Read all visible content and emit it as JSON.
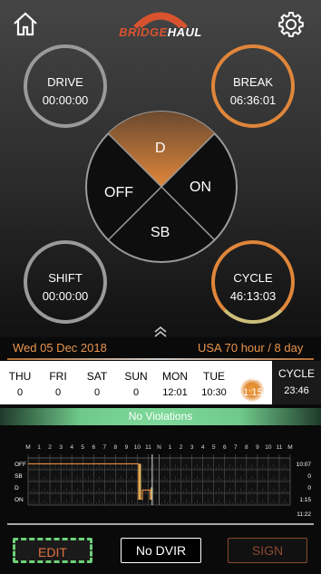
{
  "header": {
    "logo_part1": "BRIDGE",
    "logo_part2": "HAUL",
    "home_icon": "home-icon",
    "settings_icon": "gear-icon"
  },
  "timers": {
    "drive": {
      "label": "DRIVE",
      "value": "00:00:00"
    },
    "break": {
      "label": "BREAK",
      "value": "06:36:01"
    },
    "shift": {
      "label": "SHIFT",
      "value": "00:00:00"
    },
    "cycle": {
      "label": "CYCLE",
      "value": "46:13:03"
    }
  },
  "status_wheel": {
    "d": "D",
    "on": "ON",
    "off": "OFF",
    "sb": "SB",
    "active": "D",
    "active_color": "#e0863a"
  },
  "date_bar": {
    "date": "Wed 05 Dec 2018",
    "rule": "USA 70 hour / 8 day"
  },
  "days": [
    {
      "name": "THU",
      "value": "0"
    },
    {
      "name": "FRI",
      "value": "0"
    },
    {
      "name": "SAT",
      "value": "0"
    },
    {
      "name": "SUN",
      "value": "0"
    },
    {
      "name": "MON",
      "value": "12:01"
    },
    {
      "name": "TUE",
      "value": "10:30"
    },
    {
      "name": "WED",
      "value": "1:15"
    }
  ],
  "cycle_summary": {
    "label": "CYCLE",
    "value": "23:46"
  },
  "violations": "No Violations",
  "log_grid": {
    "hour_labels": [
      "M",
      "1",
      "2",
      "3",
      "4",
      "5",
      "6",
      "7",
      "8",
      "9",
      "10",
      "11",
      "N",
      "1",
      "2",
      "3",
      "4",
      "5",
      "6",
      "7",
      "8",
      "9",
      "10",
      "11",
      "M"
    ],
    "rows": [
      {
        "label": "OFF",
        "total": "10:07"
      },
      {
        "label": "SB",
        "total": "0"
      },
      {
        "label": "D",
        "total": "0"
      },
      {
        "label": "ON",
        "total": "1:15"
      }
    ],
    "grand_total": "11:22"
  },
  "buttons": {
    "edit": "EDIT",
    "dvir": "No DVIR",
    "sign": "SIGN"
  }
}
